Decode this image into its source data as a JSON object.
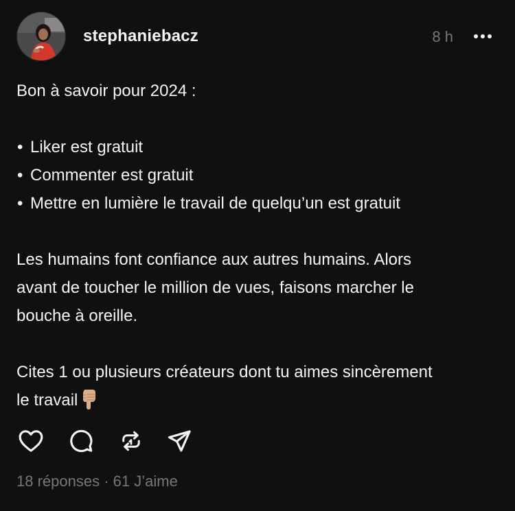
{
  "post": {
    "author": {
      "username": "stephaniebacz",
      "avatar_icon": "avatar-photo"
    },
    "time": "8 h",
    "more_icon": "more-dots-icon",
    "content": {
      "intro": "Bon à savoir pour 2024 :",
      "bullet_symbol": "•",
      "bullets": [
        "Liker est gratuit",
        "Commenter est gratuit",
        "Mettre en lumière le travail de quelqu’un est gratuit"
      ],
      "paragraph_lines": [
        "Les humains font confiance aux autres humains. Alors",
        "avant de toucher le million de vues, faisons marcher le",
        "bouche à oreille."
      ],
      "cta_lines": [
        "Cites 1 ou plusieurs créateurs dont tu aimes sincèrement",
        "le travail"
      ],
      "cta_emoji": "backhand-index-pointing-down"
    },
    "actions": [
      {
        "name": "like",
        "icon": "heart-icon"
      },
      {
        "name": "reply",
        "icon": "comment-icon"
      },
      {
        "name": "repost",
        "icon": "repost-icon"
      },
      {
        "name": "share",
        "icon": "send-icon"
      }
    ],
    "stats": {
      "replies": "18 réponses",
      "separator": " · ",
      "likes": "61 J’aime"
    },
    "colors": {
      "background": "#101010",
      "text": "#f3f5f7",
      "muted": "#777777"
    }
  }
}
